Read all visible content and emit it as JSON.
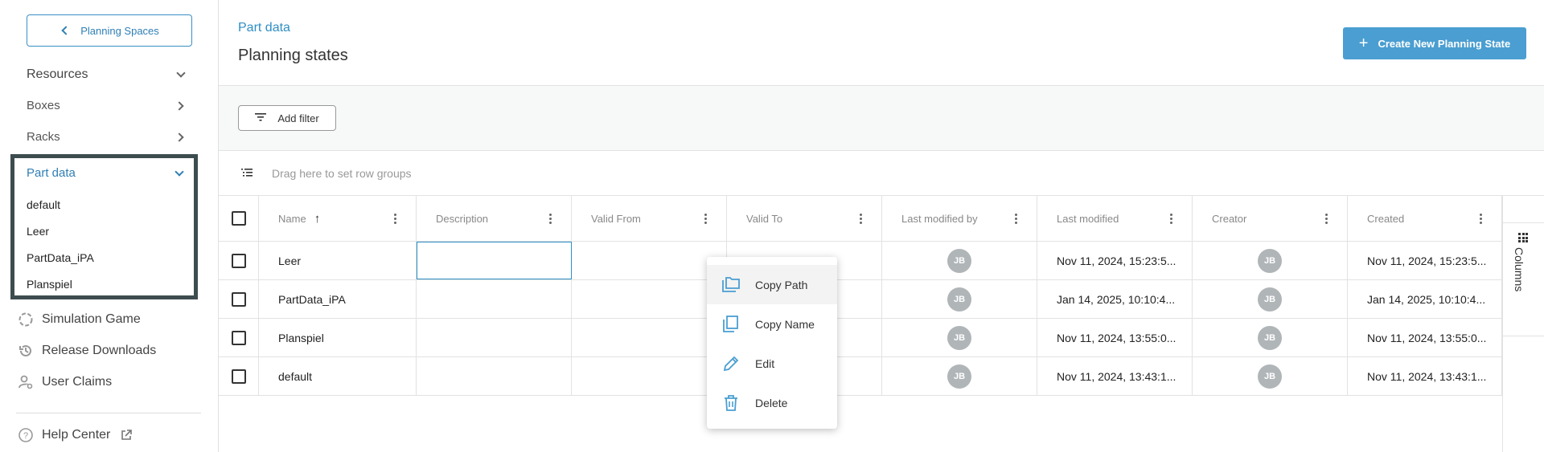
{
  "sidebar": {
    "back_label": "Planning Spaces",
    "resources_label": "Resources",
    "boxes_label": "Boxes",
    "racks_label": "Racks",
    "part_data_label": "Part data",
    "part_data_items": [
      "default",
      "Leer",
      "PartData_iPA",
      "Planspiel"
    ],
    "simulation_label": "Simulation Game",
    "release_label": "Release Downloads",
    "claims_label": "User Claims",
    "help_label": "Help Center"
  },
  "header": {
    "breadcrumb": "Part data",
    "title": "Planning states",
    "create_label": "Create New Planning State"
  },
  "filter": {
    "add_filter_label": "Add filter"
  },
  "group_bar": {
    "placeholder": "Drag here to set row groups"
  },
  "table": {
    "columns": [
      "Name",
      "Description",
      "Valid From",
      "Valid To",
      "Last modified by",
      "Last modified",
      "Creator",
      "Created"
    ],
    "rows": [
      {
        "name": "Leer",
        "description": "",
        "valid_from": "",
        "valid_to": "",
        "modified_by": "JB",
        "modified": "Nov 11, 2024, 15:23:5...",
        "creator": "JB",
        "created": "Nov 11, 2024, 15:23:5..."
      },
      {
        "name": "PartData_iPA",
        "description": "",
        "valid_from": "",
        "valid_to": "",
        "modified_by": "JB",
        "modified": "Jan 14, 2025, 10:10:4...",
        "creator": "JB",
        "created": "Jan 14, 2025, 10:10:4..."
      },
      {
        "name": "Planspiel",
        "description": "",
        "valid_from": "",
        "valid_to": "",
        "modified_by": "JB",
        "modified": "Nov 11, 2024, 13:55:0...",
        "creator": "JB",
        "created": "Nov 11, 2024, 13:55:0..."
      },
      {
        "name": "default",
        "description": "",
        "valid_from": "",
        "valid_to": "",
        "modified_by": "JB",
        "modified": "Nov 11, 2024, 13:43:1...",
        "creator": "JB",
        "created": "Nov 11, 2024, 13:43:1..."
      }
    ]
  },
  "columns_panel": {
    "label": "Columns"
  },
  "context_menu": {
    "items": [
      "Copy Path",
      "Copy Name",
      "Edit",
      "Delete"
    ]
  },
  "colors": {
    "accent": "#4a9ed1",
    "highlight_border": "#3d4c4f"
  }
}
